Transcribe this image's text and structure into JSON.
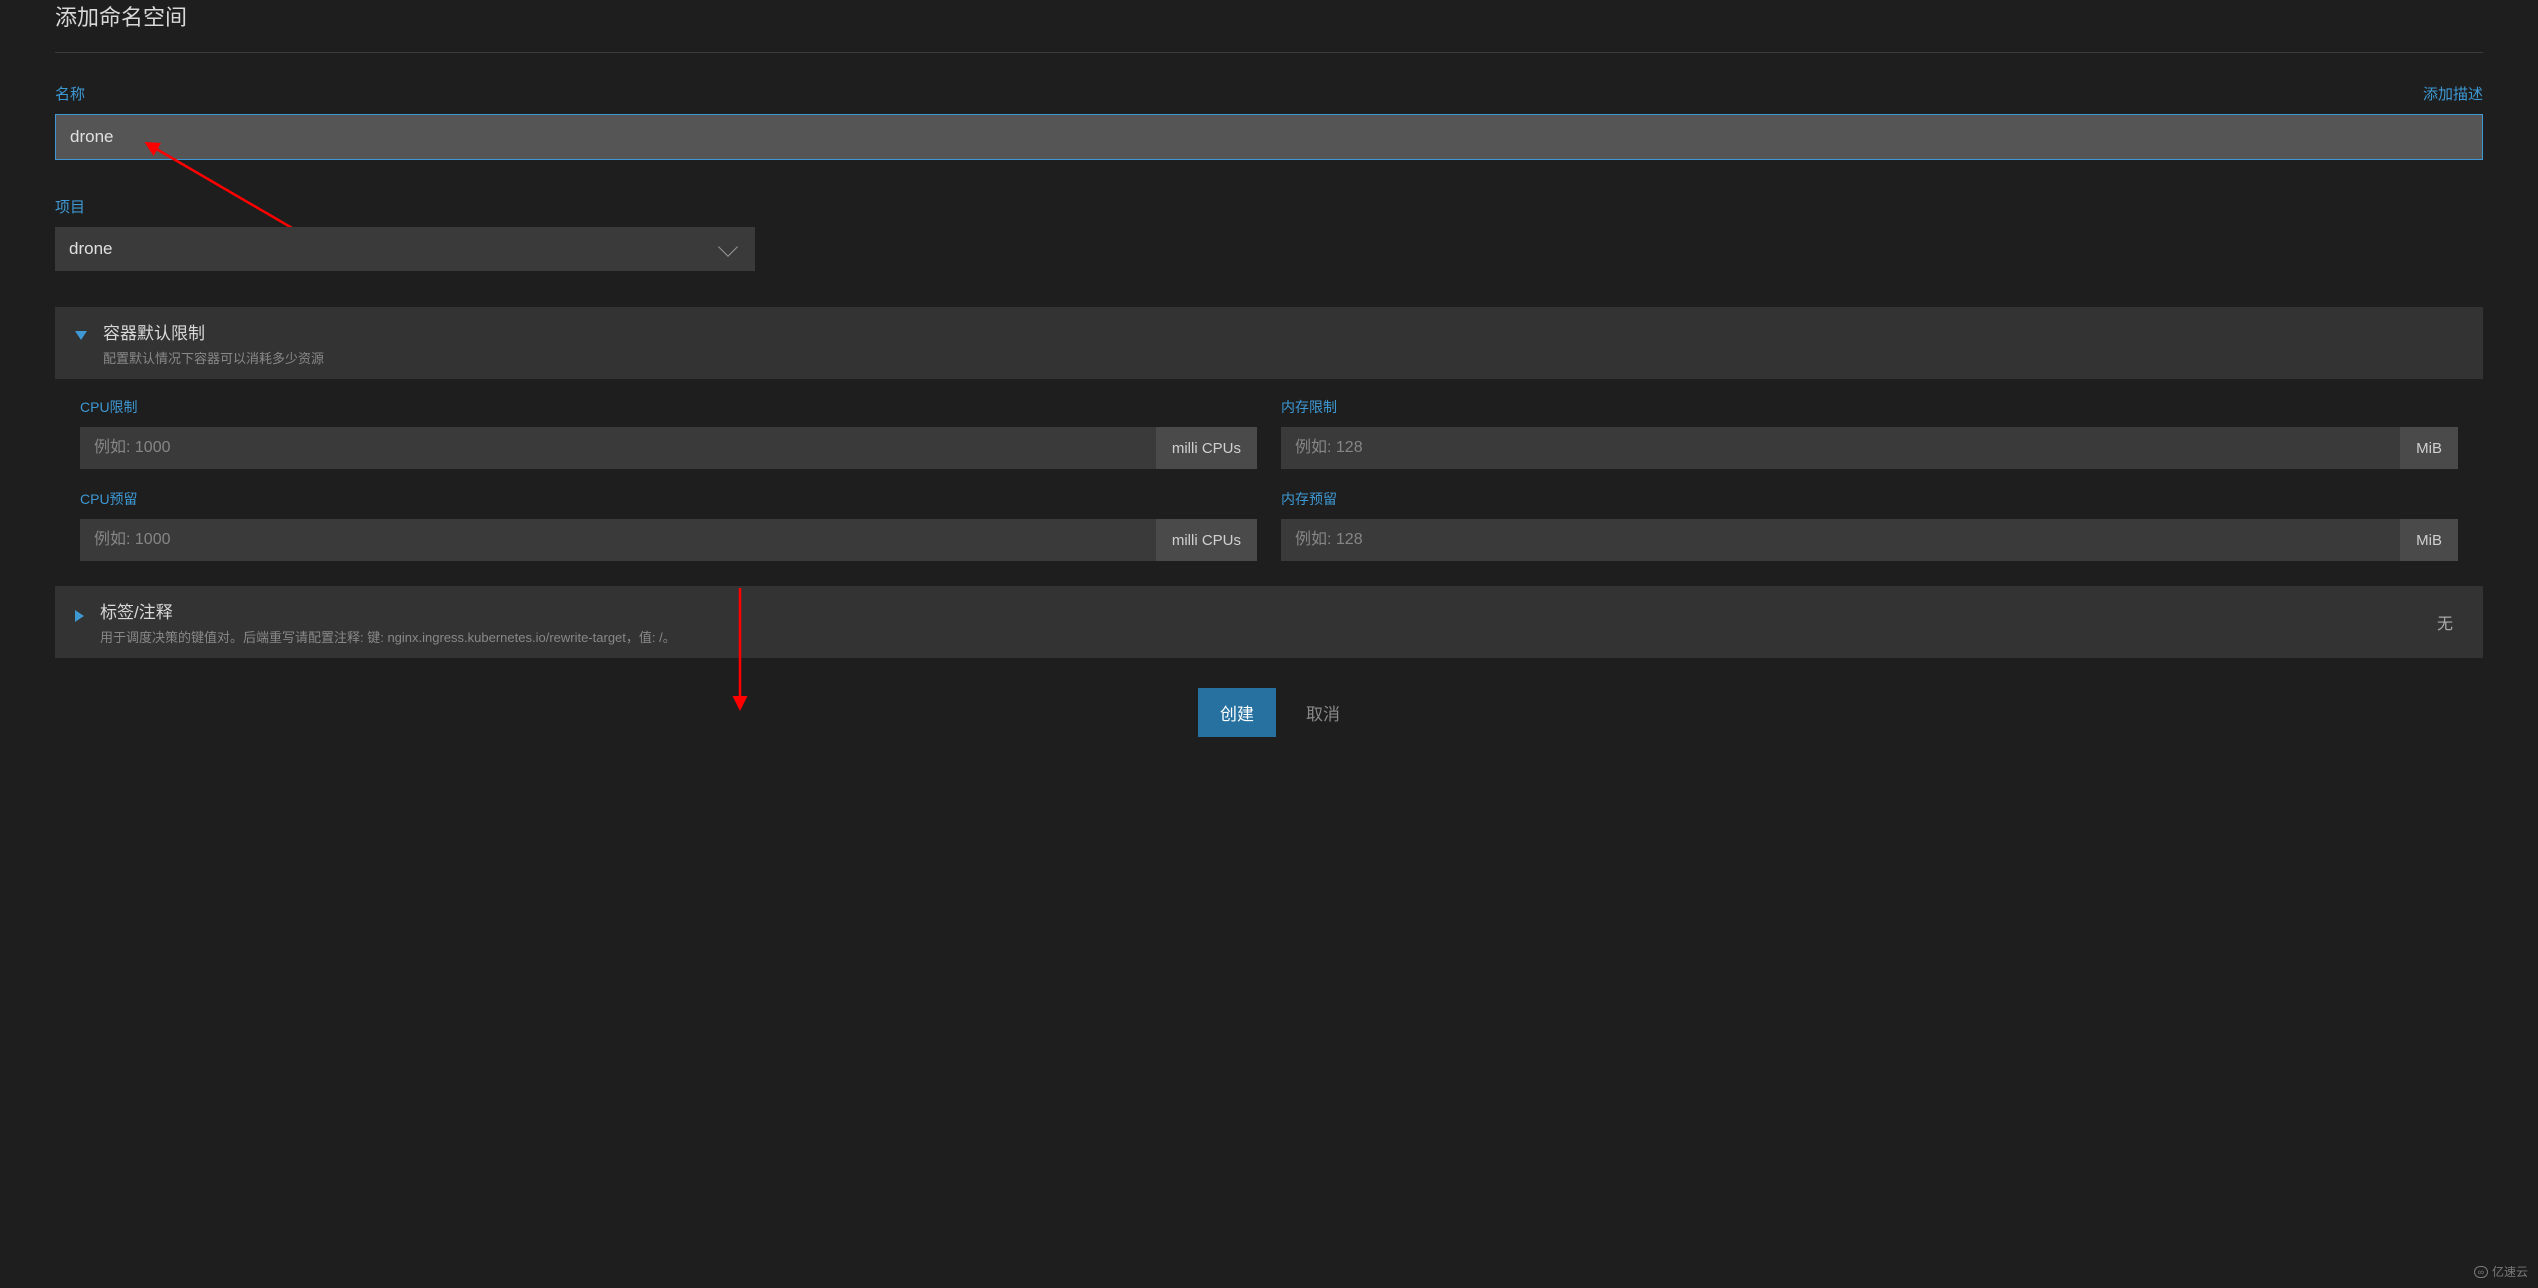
{
  "page": {
    "title": "添加命名空间"
  },
  "name_field": {
    "label": "名称",
    "value": "drone",
    "add_description_link": "添加描述"
  },
  "project_field": {
    "label": "项目",
    "selected": "drone"
  },
  "container_limits": {
    "title": "容器默认限制",
    "description": "配置默认情况下容器可以消耗多少资源",
    "cpu_limit": {
      "label": "CPU限制",
      "placeholder": "例如: 1000",
      "unit": "milli CPUs"
    },
    "mem_limit": {
      "label": "内存限制",
      "placeholder": "例如: 128",
      "unit": "MiB"
    },
    "cpu_reserve": {
      "label": "CPU预留",
      "placeholder": "例如: 1000",
      "unit": "milli CPUs"
    },
    "mem_reserve": {
      "label": "内存预留",
      "placeholder": "例如: 128",
      "unit": "MiB"
    }
  },
  "labels_section": {
    "title": "标签/注释",
    "description": "用于调度决策的键值对。后端重写请配置注释: 键: nginx.ingress.kubernetes.io/rewrite-target，值: /。",
    "status": "无"
  },
  "buttons": {
    "create": "创建",
    "cancel": "取消"
  },
  "watermark": "亿速云"
}
